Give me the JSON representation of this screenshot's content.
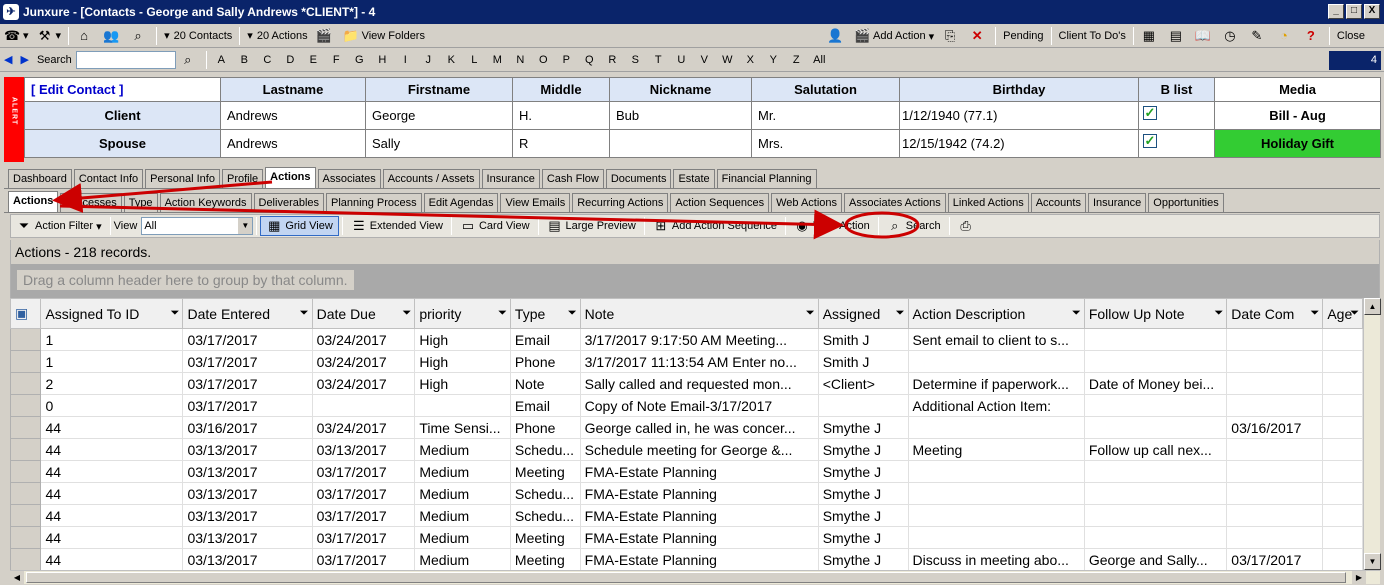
{
  "window": {
    "title": "Junxure - [Contacts - George and Sally Andrews  *CLIENT*] - 4",
    "controls": [
      "_",
      "□",
      "X"
    ]
  },
  "toolbar": {
    "contacts_count": "20 Contacts",
    "actions_count": "20 Actions",
    "view_folders": "View Folders",
    "add_action": "Add Action",
    "pending": "Pending",
    "client_todos": "Client To Do's",
    "close": "Close"
  },
  "nav": {
    "search_label": "Search",
    "letters": [
      "A",
      "B",
      "C",
      "D",
      "E",
      "F",
      "G",
      "H",
      "I",
      "J",
      "K",
      "L",
      "M",
      "N",
      "O",
      "P",
      "Q",
      "R",
      "S",
      "T",
      "U",
      "V",
      "W",
      "X",
      "Y",
      "Z",
      "All"
    ],
    "record_number": "4"
  },
  "contact": {
    "alert_text": "ALERT",
    "edit_label": "[ Edit Contact ]",
    "headers": [
      "Lastname",
      "Firstname",
      "Middle",
      "Nickname",
      "Salutation",
      "Birthday",
      "B list",
      "Media"
    ],
    "client": {
      "label": "Client",
      "lastname": "Andrews",
      "firstname": "George",
      "middle": "H.",
      "nickname": "Bub",
      "salutation": "Mr.",
      "birthday": "1/12/1940 (77.1)",
      "media": "Bill - Aug"
    },
    "spouse": {
      "label": "Spouse",
      "lastname": "Andrews",
      "firstname": "Sally",
      "middle": "R",
      "nickname": "",
      "salutation": "Mrs.",
      "birthday": "12/15/1942 (74.2)",
      "media": "Holiday Gift"
    }
  },
  "tabs_main": [
    "Dashboard",
    "Contact Info",
    "Personal Info",
    "Profile",
    "Actions",
    "Associates",
    "Accounts / Assets",
    "Insurance",
    "Cash Flow",
    "Documents",
    "Estate",
    "Financial Planning"
  ],
  "tabs_sub": [
    "Actions",
    "Processes",
    "Type",
    "Action Keywords",
    "Deliverables",
    "Planning Process",
    "Edit Agendas",
    "View Emails",
    "Recurring Actions",
    "Action Sequences",
    "Web Actions",
    "Associates Actions",
    "Linked Actions",
    "Accounts",
    "Insurance",
    "Opportunities"
  ],
  "grid_toolbar": {
    "action_filter": "Action Filter",
    "view_label": "View",
    "view_value": "All",
    "grid_view": "Grid View",
    "extended_view": "Extended View",
    "card_view": "Card View",
    "large_preview": "Large Preview",
    "add_action_sequence": "Add Action Sequence",
    "view_action": "View Action",
    "search": "Search"
  },
  "records_text": "Actions - 218 records.",
  "group_hint": "Drag a column header here to group by that column.",
  "columns": [
    "Assigned To ID",
    "Date Entered",
    "Date Due",
    "priority",
    "Type",
    "Note",
    "Assigned",
    "Action Description",
    "Follow Up Note",
    "Date Com",
    "Age"
  ],
  "rows": [
    [
      "1",
      "03/17/2017",
      "03/24/2017",
      "High",
      "Email",
      "3/17/2017 9:17:50 AM Meeting...",
      "Smith J",
      "Sent email to client to s...",
      "",
      "",
      ""
    ],
    [
      "1",
      "03/17/2017",
      "03/24/2017",
      "High",
      "Phone",
      "3/17/2017 11:13:54 AM Enter no...",
      "Smith J",
      "",
      "",
      "",
      ""
    ],
    [
      "2",
      "03/17/2017",
      "03/24/2017",
      "High",
      "Note",
      "Sally called and requested mon...",
      "<Client>",
      "Determine if paperwork...",
      "Date of Money bei...",
      "",
      ""
    ],
    [
      "0",
      "03/17/2017",
      "",
      "",
      "Email",
      "Copy of Note Email-3/17/2017",
      "",
      "Additional Action Item:",
      "",
      "",
      ""
    ],
    [
      "44",
      "03/16/2017",
      "03/24/2017",
      "Time Sensi...",
      "Phone",
      "George called in, he was concer...",
      "Smythe J",
      "",
      "",
      "03/16/2017",
      ""
    ],
    [
      "44",
      "03/13/2017",
      "03/13/2017",
      "Medium",
      "Schedu...",
      "Schedule meeting for George &...",
      "Smythe J",
      "Meeting",
      "Follow up call nex...",
      "",
      ""
    ],
    [
      "44",
      "03/13/2017",
      "03/17/2017",
      "Medium",
      "Meeting",
      "FMA-Estate Planning",
      "Smythe J",
      "",
      "",
      "",
      ""
    ],
    [
      "44",
      "03/13/2017",
      "03/17/2017",
      "Medium",
      "Schedu...",
      "FMA-Estate Planning",
      "Smythe J",
      "",
      "",
      "",
      ""
    ],
    [
      "44",
      "03/13/2017",
      "03/17/2017",
      "Medium",
      "Schedu...",
      "FMA-Estate Planning",
      "Smythe J",
      "",
      "",
      "",
      ""
    ],
    [
      "44",
      "03/13/2017",
      "03/17/2017",
      "Medium",
      "Meeting",
      "FMA-Estate Planning",
      "Smythe J",
      "",
      "",
      "",
      ""
    ],
    [
      "44",
      "03/13/2017",
      "03/17/2017",
      "Medium",
      "Meeting",
      "FMA-Estate Planning",
      "Smythe J",
      "Discuss in meeting abo...",
      "George and Sally...",
      "03/17/2017",
      ""
    ]
  ],
  "colors": {
    "titlebar": "#0a246a",
    "alert": "#ff0000",
    "holiday_gift": "#33cc33",
    "annotation": "#cc0000"
  }
}
